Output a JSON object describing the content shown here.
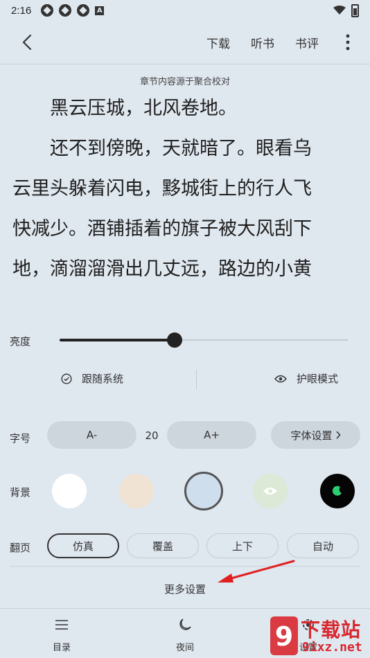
{
  "status_bar": {
    "time": "2:16",
    "a_icon": "A"
  },
  "toolbar": {
    "download": "下载",
    "listen": "听书",
    "review": "书评"
  },
  "source_note": "章节内容源于聚合校对",
  "reading": {
    "lines": [
      "　　黑云压城，北风卷地。",
      "　　还不到傍晚，天就暗了。眼看乌",
      "云里头躲着闪电，黟城街上的行人飞",
      "快减少。酒铺插着的旗子被大风刮下",
      "地，滴溜溜滑出几丈远，路边的小黄"
    ]
  },
  "settings": {
    "brightness_label": "亮度",
    "brightness_value": 0.4,
    "follow_system": "跟随系统",
    "eye_protection": "护眼模式",
    "font_label": "字号",
    "font_minus": "A-",
    "font_size": "20",
    "font_plus": "A+",
    "font_settings": "字体设置",
    "background_label": "背景",
    "backgrounds": [
      {
        "name": "white",
        "color": "#ffffff"
      },
      {
        "name": "beige",
        "color": "#f0e3d3"
      },
      {
        "name": "blue",
        "color": "#cfdeed",
        "selected": true
      },
      {
        "name": "green-eye",
        "color": "#dce9d6"
      },
      {
        "name": "night",
        "color": "#050505"
      }
    ],
    "page_turn_label": "翻页",
    "page_modes": [
      "仿真",
      "覆盖",
      "上下",
      "自动"
    ],
    "page_mode_selected": "仿真",
    "more_settings": "更多设置"
  },
  "bottom_nav": {
    "contents": "目录",
    "night": "夜间",
    "settings": "设置"
  },
  "watermark": {
    "top": "下载站",
    "bottom": "9ixz.net",
    "logo": "9"
  },
  "colors": {
    "background": "#dfe7ef",
    "pill": "#cdd5dd",
    "arrow": "#e02020",
    "watermark": "#d9272e"
  }
}
